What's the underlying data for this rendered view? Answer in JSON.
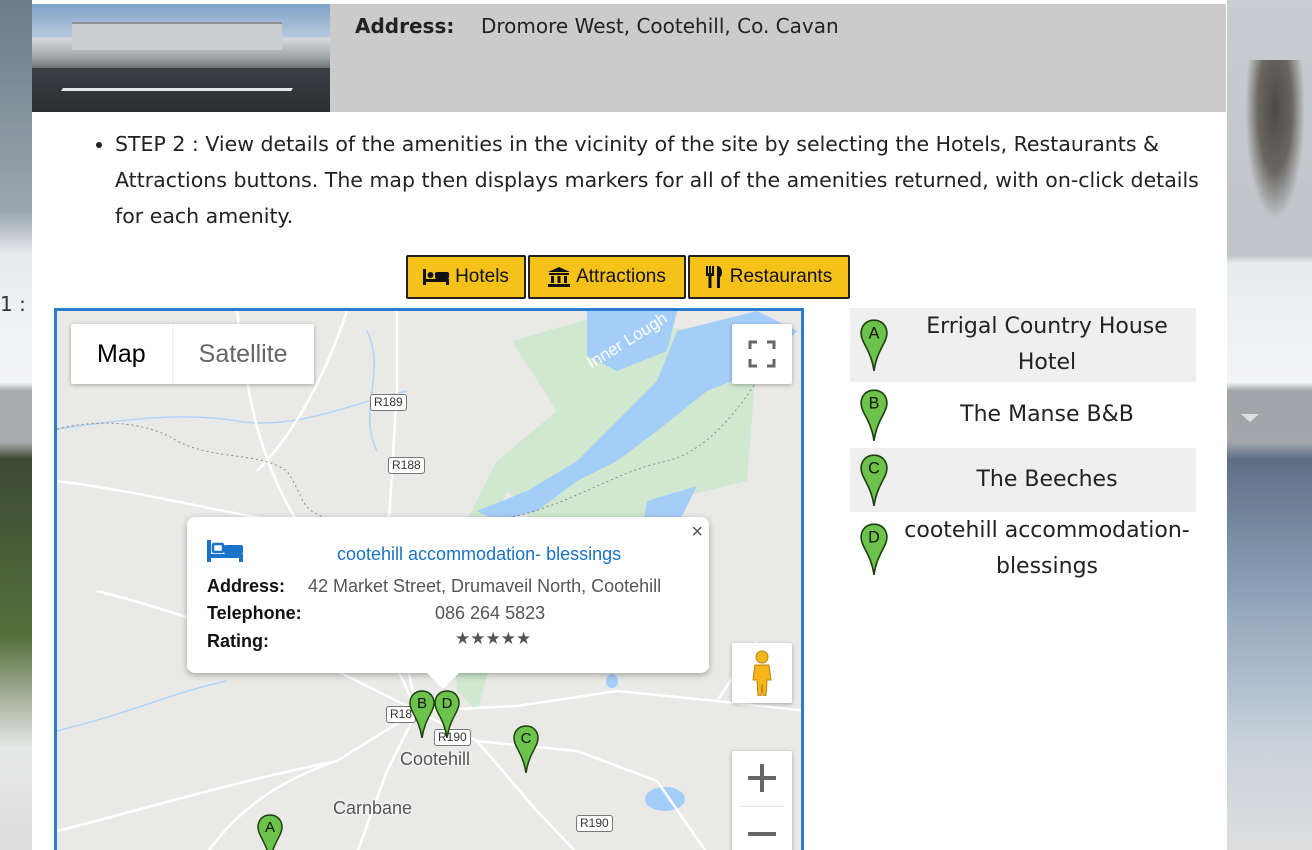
{
  "background": {
    "left_fragment": "1 :"
  },
  "site": {
    "address_label": "Address:",
    "address_value": "Dromore West, Cootehill, Co. Cavan"
  },
  "instructions": {
    "step2": "STEP 2 : View details of the amenities in the vicinity of the site by selecting the Hotels, Restaurants & Attractions buttons. The map then displays markers for all of the amenities returned, with on-click details for each amenity."
  },
  "buttons": {
    "hotels": "Hotels",
    "attractions": "Attractions",
    "restaurants": "Restaurants",
    "color": "#f6c21a"
  },
  "map": {
    "type_controls": {
      "map": "Map",
      "satellite": "Satellite",
      "selected": "Map"
    },
    "road_labels": [
      "R189",
      "R188",
      "R18",
      "R190",
      "R190"
    ],
    "place_labels": {
      "cootehill": "Cootehill",
      "carnbane": "Carnbane",
      "lough": "Inner Lough"
    },
    "markers": [
      "A",
      "B",
      "C",
      "D"
    ],
    "marker_color": "#6cc24a",
    "controls": [
      "fullscreen-icon",
      "pegman-icon",
      "zoom-in",
      "zoom-out"
    ]
  },
  "infowindow": {
    "icon": "bed-icon",
    "name": "cootehill accommodation- blessings",
    "address_label": "Address:",
    "address_value": "42 Market Street, Drumaveil North, Cootehill",
    "telephone_label": "Telephone:",
    "telephone_value": "086 264 5823",
    "rating_label": "Rating:",
    "rating_stars": "★★★★★",
    "close": "×"
  },
  "amenities": [
    {
      "letter": "A",
      "name": "Errigal Country House Hotel"
    },
    {
      "letter": "B",
      "name": "The Manse B&B"
    },
    {
      "letter": "C",
      "name": "The Beeches"
    },
    {
      "letter": "D",
      "name": "cootehill accommodation- blessings"
    }
  ]
}
